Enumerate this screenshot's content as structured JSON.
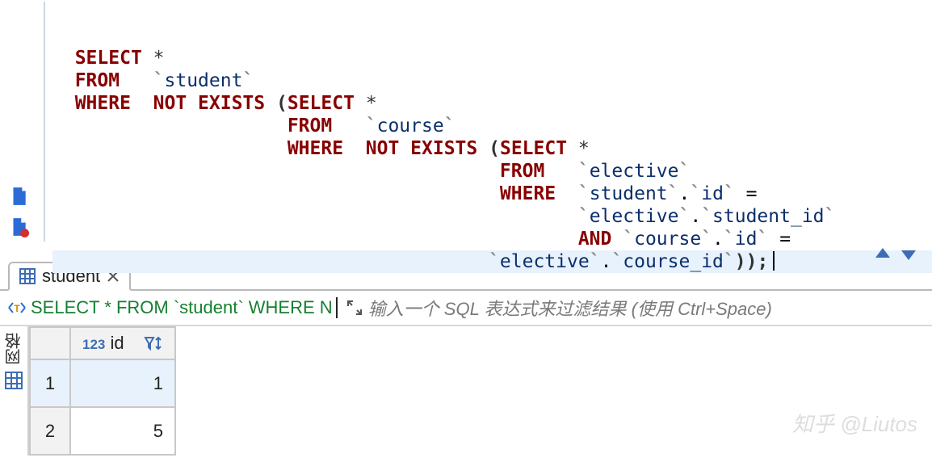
{
  "editor": {
    "lines": [
      [
        [
          "kw",
          "SELECT"
        ],
        [
          "sp",
          " "
        ],
        [
          "star",
          "*"
        ]
      ],
      [
        [
          "kw",
          "FROM"
        ],
        [
          "sp",
          "   "
        ],
        [
          "bt",
          "`"
        ],
        [
          "id",
          "student"
        ],
        [
          "bt",
          "`"
        ]
      ],
      [
        [
          "kw",
          "WHERE"
        ],
        [
          "sp",
          "  "
        ],
        [
          "kw",
          "NOT EXISTS"
        ],
        [
          "sp",
          " "
        ],
        [
          "paren",
          "("
        ],
        [
          "kw",
          "SELECT"
        ],
        [
          "sp",
          " "
        ],
        [
          "star",
          "*"
        ]
      ],
      [
        [
          "sp",
          "                   "
        ],
        [
          "kw",
          "FROM"
        ],
        [
          "sp",
          "   "
        ],
        [
          "bt",
          "`"
        ],
        [
          "id",
          "course"
        ],
        [
          "bt",
          "`"
        ]
      ],
      [
        [
          "sp",
          "                   "
        ],
        [
          "kw",
          "WHERE"
        ],
        [
          "sp",
          "  "
        ],
        [
          "kw",
          "NOT EXISTS"
        ],
        [
          "sp",
          " "
        ],
        [
          "paren",
          "("
        ],
        [
          "kw",
          "SELECT"
        ],
        [
          "sp",
          " "
        ],
        [
          "star",
          "*"
        ]
      ],
      [
        [
          "sp",
          "                                      "
        ],
        [
          "kw",
          "FROM"
        ],
        [
          "sp",
          "   "
        ],
        [
          "bt",
          "`"
        ],
        [
          "id",
          "elective"
        ],
        [
          "bt",
          "`"
        ]
      ],
      [
        [
          "sp",
          "                                      "
        ],
        [
          "kw",
          "WHERE"
        ],
        [
          "sp",
          "  "
        ],
        [
          "bt",
          "`"
        ],
        [
          "id",
          "student"
        ],
        [
          "bt",
          "`"
        ],
        [
          "op",
          "."
        ],
        [
          "bt",
          "`"
        ],
        [
          "id",
          "id"
        ],
        [
          "bt",
          "`"
        ],
        [
          "sp",
          " "
        ],
        [
          "op",
          "="
        ]
      ],
      [
        [
          "sp",
          "                                             "
        ],
        [
          "bt",
          "`"
        ],
        [
          "id",
          "elective"
        ],
        [
          "bt",
          "`"
        ],
        [
          "op",
          "."
        ],
        [
          "bt",
          "`"
        ],
        [
          "id",
          "student_id"
        ],
        [
          "bt",
          "`"
        ]
      ],
      [
        [
          "sp",
          "                                             "
        ],
        [
          "kw",
          "AND"
        ],
        [
          "sp",
          " "
        ],
        [
          "bt",
          "`"
        ],
        [
          "id",
          "course"
        ],
        [
          "bt",
          "`"
        ],
        [
          "op",
          "."
        ],
        [
          "bt",
          "`"
        ],
        [
          "id",
          "id"
        ],
        [
          "bt",
          "`"
        ],
        [
          "sp",
          " "
        ],
        [
          "op",
          "="
        ]
      ],
      [
        [
          "sp",
          "                                     "
        ],
        [
          "bt",
          "`"
        ],
        [
          "id",
          "elective"
        ],
        [
          "bt",
          "`"
        ],
        [
          "op",
          "."
        ],
        [
          "bt",
          "`"
        ],
        [
          "id",
          "course_id"
        ],
        [
          "bt",
          "`"
        ],
        [
          "paren",
          ")"
        ],
        [
          "paren",
          ")"
        ],
        [
          "semi",
          ";"
        ],
        [
          "cursor",
          ""
        ]
      ]
    ],
    "hl_index": 9
  },
  "tab": {
    "label": "student"
  },
  "filter": {
    "sql": "SELECT * FROM `student` WHERE N",
    "placeholder": "输入一个 SQL 表达式来过滤结果 (使用 Ctrl+Space)"
  },
  "grid": {
    "side_label": "网格",
    "header_prefix": "123",
    "header_name": "id",
    "rows": [
      {
        "n": "1",
        "id": "1"
      },
      {
        "n": "2",
        "id": "5"
      }
    ],
    "selected": 0
  },
  "watermark": "知乎 @Liutos",
  "chart_data": {
    "type": "table",
    "title": "student",
    "columns": [
      "id"
    ],
    "rows": [
      [
        1
      ],
      [
        5
      ]
    ]
  }
}
